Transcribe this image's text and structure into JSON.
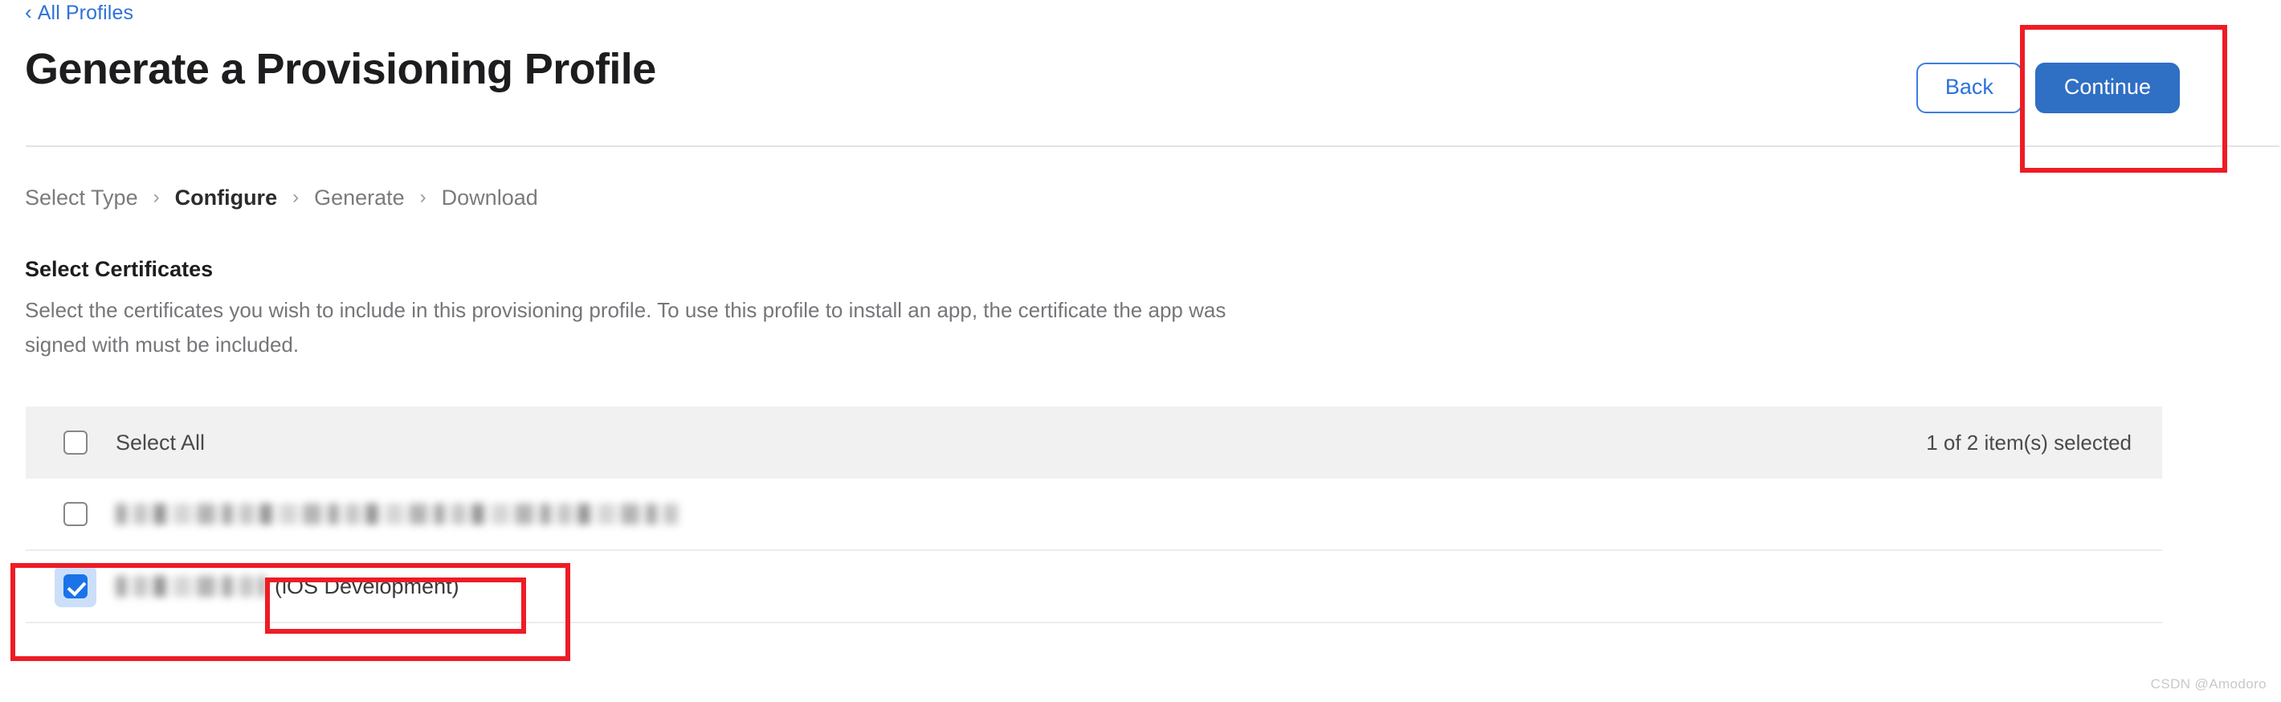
{
  "breadcrumb": {
    "back_icon": "chevron-left-icon",
    "back_label": "All Profiles"
  },
  "header": {
    "title": "Generate a Provisioning Profile",
    "back_button": "Back",
    "continue_button": "Continue"
  },
  "steps": [
    {
      "label": "Select Type",
      "active": false
    },
    {
      "label": "Configure",
      "active": true
    },
    {
      "label": "Generate",
      "active": false
    },
    {
      "label": "Download",
      "active": false
    }
  ],
  "step_separator": "›",
  "section": {
    "title": "Select Certificates",
    "description": "Select the certificates you wish to include in this provisioning profile. To use this profile to install an app, the certificate the app was signed with must be included."
  },
  "table": {
    "select_all_label": "Select All",
    "selection_count": "1 of 2 item(s) selected",
    "rows": [
      {
        "checked": false,
        "name_redacted": true,
        "name": "",
        "suffix": ""
      },
      {
        "checked": true,
        "name_redacted": true,
        "name": "",
        "suffix": "(iOS Development)"
      }
    ]
  },
  "annotations": [
    {
      "name": "continue-button-highlight",
      "color": "#ee1c25"
    },
    {
      "name": "selected-certificate-row-highlight",
      "color": "#ee1c25"
    },
    {
      "name": "ios-development-label-highlight",
      "color": "#ee1c25"
    }
  ],
  "colors": {
    "link": "#2d72d9",
    "primary_button": "#2f6fc4",
    "checkbox_checked": "#1a73e8",
    "annotation": "#ee1c25",
    "table_header_bg": "#f1f1f1"
  },
  "watermark": "CSDN @Amodoro"
}
